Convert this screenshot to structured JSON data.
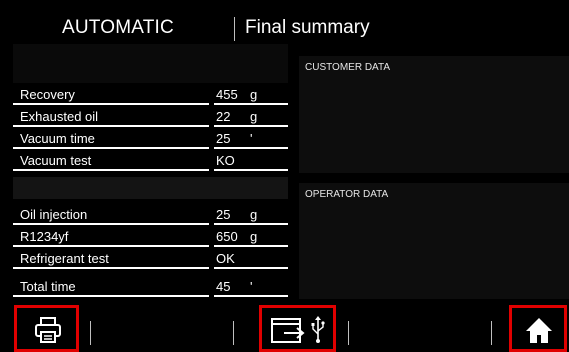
{
  "header": {
    "mode": "AUTOMATIC",
    "title": "Final summary"
  },
  "summary": {
    "rows": [
      {
        "label": "Recovery",
        "value": "455",
        "unit": "g"
      },
      {
        "label": "Exhausted oil",
        "value": "22",
        "unit": "g"
      },
      {
        "label": "Vacuum time",
        "value": "25",
        "unit": "'"
      },
      {
        "label": "Vacuum test",
        "value": "KO",
        "unit": ""
      },
      {
        "label": "Oil injection",
        "value": "25",
        "unit": "g"
      },
      {
        "label": "R1234yf",
        "value": "650",
        "unit": "g"
      },
      {
        "label": "Refrigerant test",
        "value": "OK",
        "unit": ""
      },
      {
        "label": "Total time",
        "value": "45",
        "unit": "'"
      }
    ]
  },
  "panels": {
    "customer": "CUSTOMER DATA",
    "operator": "OPERATOR DATA"
  },
  "toolbar": {
    "icons": [
      "printer-icon",
      "window-export-icon",
      "usb-icon",
      "home-icon"
    ],
    "accent": "#e00000"
  }
}
